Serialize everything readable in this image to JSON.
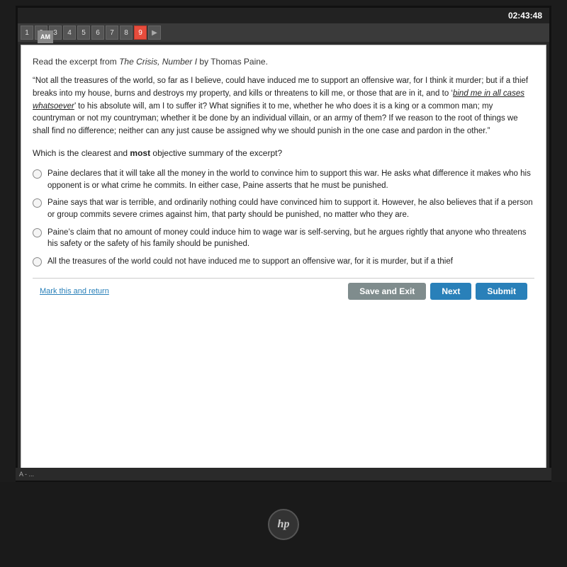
{
  "os": {
    "time": "02:43:48"
  },
  "tabs": [
    {
      "label": "1",
      "active": false
    },
    {
      "label": "2",
      "active": false
    },
    {
      "label": "3",
      "active": false
    },
    {
      "label": "4",
      "active": false
    },
    {
      "label": "5",
      "active": false
    },
    {
      "label": "6",
      "active": false
    },
    {
      "label": "7",
      "active": false
    },
    {
      "label": "8",
      "active": false
    },
    {
      "label": "9",
      "active": true
    },
    {
      "label": "▶",
      "active": false
    }
  ],
  "exam": {
    "instruction": "Read the excerpt from The Crisis, Number I by Thomas Paine.",
    "passage": "“Not all the treasures of the world, so far as I believe, could have induced me to support an offensive war, for I think it murder; but if a thief breaks into my house, burns and destroys my property, and kills or threatens to kill me, or those that are in it, and to ‘bind me in all cases whatsoever’ to his absolute will, am I to suffer it? What signifies it to me, whether he who does it is a king or a common man; my countryman or not my countryman; whether it be done by an individual villain, or an army of them? If we reason to the root of things we shall find no difference; neither can any just cause be assigned why we should punish in the one case and pardon in the other.”",
    "italic_underline_phrase": "bind me in all cases whatsoever",
    "question": "Which is the clearest and most objective summary of the excerpt?",
    "options": [
      {
        "id": "a",
        "text": "Paine declares that it will take all the money in the world to convince him to support this war. He asks what difference it makes who his opponent is or what crime he commits. In either case, Paine asserts that he must be punished."
      },
      {
        "id": "b",
        "text": "Paine says that war is terrible, and ordinarily nothing could have convinced him to support it. However, he also believes that if a person or group commits severe crimes against him, that party should be punished, no matter who they are."
      },
      {
        "id": "c",
        "text": "Paine's claim that no amount of money could induce him to wage war is self-serving, but he argues rightly that anyone who threatens his safety or the safety of his family should be punished."
      },
      {
        "id": "d",
        "text": "All the treasures of the world could not have induced me to support an offensive war, for it is murder, but if a thief"
      }
    ],
    "buttons": {
      "mark": "Mark this and return",
      "save": "Save and Exit",
      "next": "Next",
      "submit": "Submit"
    }
  }
}
